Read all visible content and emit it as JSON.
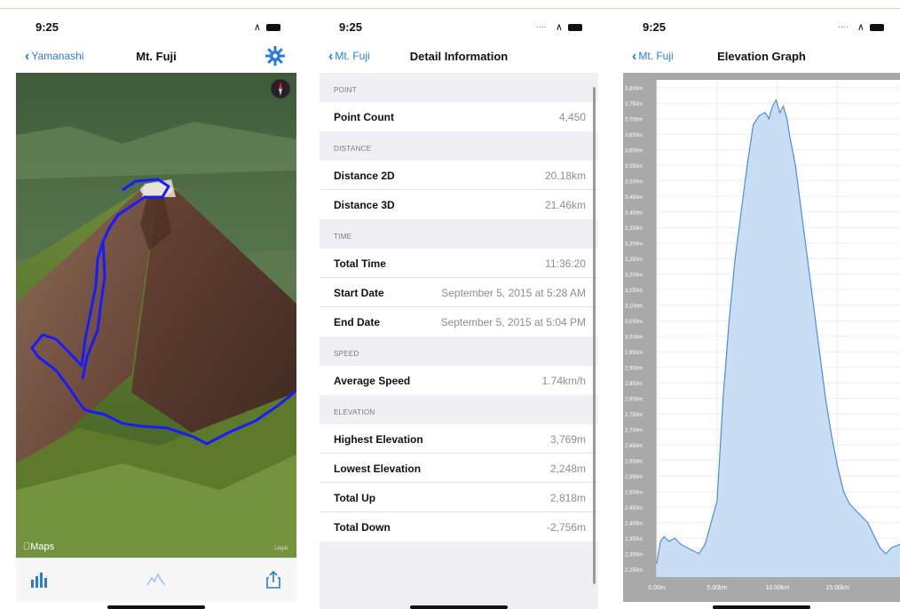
{
  "screen1": {
    "status": {
      "time": "9:25"
    },
    "nav": {
      "back_label": "Yamanashi",
      "title": "Mt. Fuji"
    },
    "map": {
      "attribution": "Maps",
      "legal": "Legal"
    },
    "toolbar": {
      "items": [
        {
          "icon": "bar-chart-icon",
          "name": "chart-button"
        },
        {
          "icon": "mountain-icon",
          "name": "elevation-button"
        },
        {
          "icon": "share-icon",
          "name": "share-button"
        }
      ]
    },
    "colors": {
      "accent": "#2b7cd6",
      "track": "#1a1aff"
    }
  },
  "screen2": {
    "status": {
      "time": "9:25"
    },
    "nav": {
      "back_label": "Mt. Fuji",
      "title": "Detail Information"
    },
    "sections": [
      {
        "header": "POINT",
        "rows": [
          {
            "label": "Point Count",
            "value": "4,450"
          }
        ]
      },
      {
        "header": "DISTANCE",
        "rows": [
          {
            "label": "Distance 2D",
            "value": "20.18km"
          },
          {
            "label": "Distance 3D",
            "value": "21.46km"
          }
        ]
      },
      {
        "header": "TIME",
        "rows": [
          {
            "label": "Total Time",
            "value": "11:36:20"
          },
          {
            "label": "Start Date",
            "value": "September 5, 2015 at 5:28 AM"
          },
          {
            "label": "End Date",
            "value": "September 5, 2015 at 5:04 PM"
          }
        ]
      },
      {
        "header": "SPEED",
        "rows": [
          {
            "label": "Average Speed",
            "value": "1.74km/h"
          }
        ]
      },
      {
        "header": "ELEVATION",
        "rows": [
          {
            "label": "Highest Elevation",
            "value": "3,769m"
          },
          {
            "label": "Lowest Elevation",
            "value": "2,248m"
          },
          {
            "label": "Total Up",
            "value": "2,818m"
          },
          {
            "label": "Total Down",
            "value": "-2,756m"
          }
        ]
      }
    ]
  },
  "screen3": {
    "status": {
      "time": "9:25"
    },
    "nav": {
      "back_label": "Mt. Fuji",
      "title": "Elevation Graph"
    }
  },
  "chart_data": {
    "type": "area",
    "title": "Elevation Graph",
    "xlabel": "",
    "ylabel": "",
    "x_tick_labels": [
      "0.00m",
      "5.00km",
      "10.00km",
      "15.00km"
    ],
    "y_tick_labels": [
      "3,800m",
      "3,750m",
      "3,700m",
      "3,650m",
      "3,600m",
      "3,550m",
      "3,500m",
      "3,450m",
      "3,400m",
      "3,350m",
      "3,300m",
      "3,250m",
      "3,200m",
      "3,150m",
      "3,100m",
      "3,050m",
      "3,000m",
      "2,950m",
      "2,900m",
      "2,850m",
      "2,800m",
      "2,750m",
      "2,700m",
      "2,650m",
      "2,600m",
      "2,550m",
      "2,500m",
      "2,450m",
      "2,400m",
      "2,350m",
      "2,300m",
      "2,250m"
    ],
    "xlim": [
      0,
      20.18
    ],
    "ylim": [
      2225,
      3825
    ],
    "grid": true,
    "series": [
      {
        "x": [
          0,
          0.3,
          0.6,
          1.0,
          1.5,
          2.0,
          2.5,
          3.0,
          3.5,
          4.0,
          4.5,
          5.0,
          5.5,
          6.0,
          6.5,
          7.0,
          7.5,
          8.0,
          8.5,
          9.0,
          9.3,
          9.6,
          9.9,
          10.2,
          10.5,
          10.8,
          11.0,
          11.5,
          12.0,
          12.5,
          13.0,
          13.5,
          14.0,
          14.5,
          15.0,
          15.5,
          16.0,
          16.5,
          17.0,
          17.5,
          18.0,
          18.5,
          19.0,
          19.5,
          20.18
        ],
        "y": [
          2270,
          2340,
          2355,
          2340,
          2350,
          2330,
          2320,
          2310,
          2300,
          2330,
          2400,
          2470,
          2800,
          3050,
          3250,
          3400,
          3550,
          3680,
          3710,
          3720,
          3700,
          3740,
          3760,
          3720,
          3740,
          3700,
          3650,
          3550,
          3400,
          3250,
          3100,
          2950,
          2800,
          2680,
          2580,
          2500,
          2460,
          2440,
          2420,
          2400,
          2360,
          2320,
          2300,
          2320,
          2330
        ]
      }
    ],
    "colors": {
      "fill": "#c9def5",
      "line": "#4a8fe0",
      "plot_bg": "#ffffff",
      "axis_bg": "#a9a9a9"
    }
  }
}
